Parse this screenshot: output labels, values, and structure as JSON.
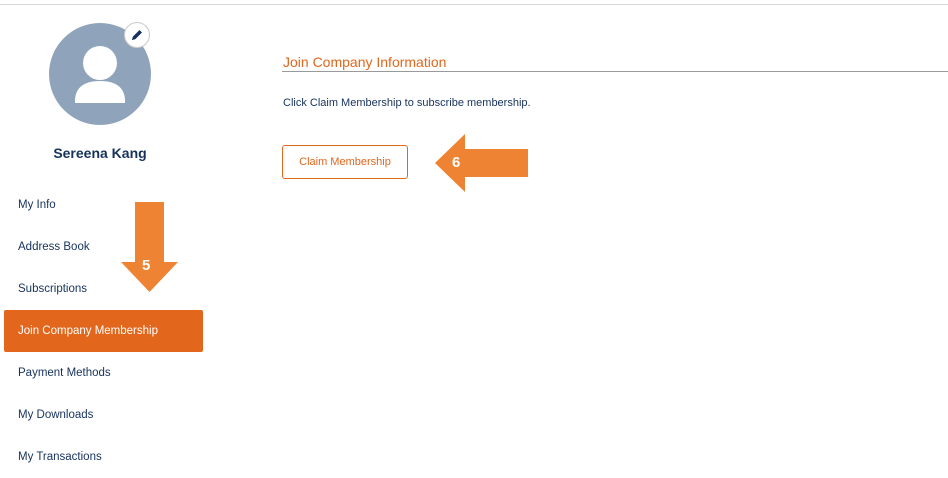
{
  "profile": {
    "name": "Sereena Kang",
    "avatar_icon": "user-silhouette-icon",
    "edit_icon": "pencil-icon"
  },
  "sidebar": {
    "items": [
      {
        "label": "My Info",
        "active": false
      },
      {
        "label": "Address Book",
        "active": false
      },
      {
        "label": "Subscriptions",
        "active": false
      },
      {
        "label": "Join Company Membership",
        "active": true
      },
      {
        "label": "Payment Methods",
        "active": false
      },
      {
        "label": "My Downloads",
        "active": false
      },
      {
        "label": "My Transactions",
        "active": false
      }
    ]
  },
  "main": {
    "section_title": "Join Company Information",
    "instruction": "Click Claim Membership to subscribe membership.",
    "claim_button_label": "Claim Membership"
  },
  "annotations": {
    "step_5": "5",
    "step_6": "6"
  },
  "colors": {
    "accent": "#e2661c",
    "annotation_arrow": "#ee8433",
    "text": "#16325c",
    "avatar_bg": "#8fa4bb"
  }
}
